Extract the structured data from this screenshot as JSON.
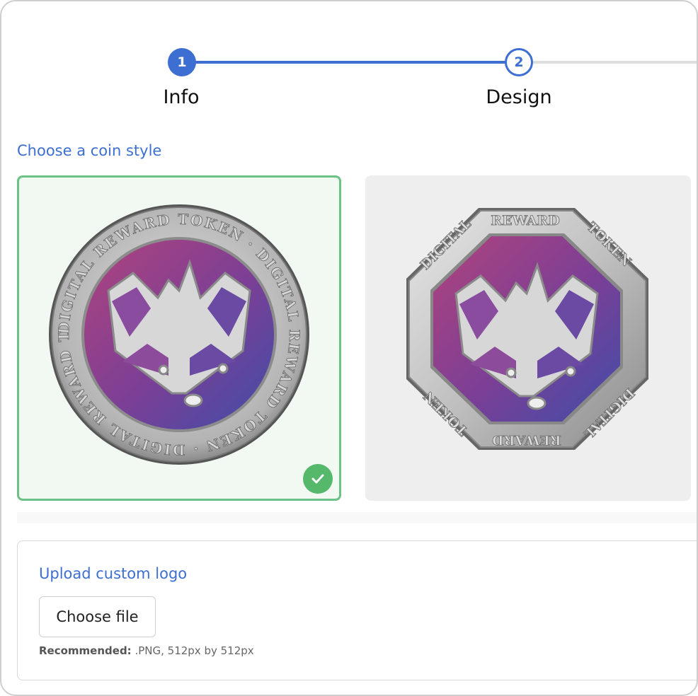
{
  "stepper": {
    "steps": [
      {
        "number": "1",
        "label": "Info",
        "state": "completed"
      },
      {
        "number": "2",
        "label": "Design",
        "state": "active"
      }
    ],
    "colors": {
      "active": "#3c6fd1",
      "inactive": "#dedede"
    }
  },
  "coin_style": {
    "title": "Choose a coin style",
    "options": [
      {
        "shape": "round",
        "ring_text": "DIGITAL REWARD TOKEN",
        "selected": true,
        "icon": "raccoon-icon"
      },
      {
        "shape": "octagon",
        "ring_text": [
          "DIGITAL",
          "REWARD",
          "TOKEN",
          "DIGITAL",
          "REWARD",
          "TOKEN"
        ],
        "selected": false,
        "icon": "raccoon-icon"
      }
    ],
    "selected_icon": "check-icon",
    "colors": {
      "selected_border": "#6cc184",
      "selected_bg": "#f1f9f2",
      "check": "#55b86a",
      "coin_face_start": "#a23f7e",
      "coin_face_end": "#4a4aa8"
    }
  },
  "upload": {
    "title": "Upload custom logo",
    "button_label": "Choose file",
    "hint_bold": "Recommended:",
    "hint_text": " .PNG, 512px by 512px"
  }
}
